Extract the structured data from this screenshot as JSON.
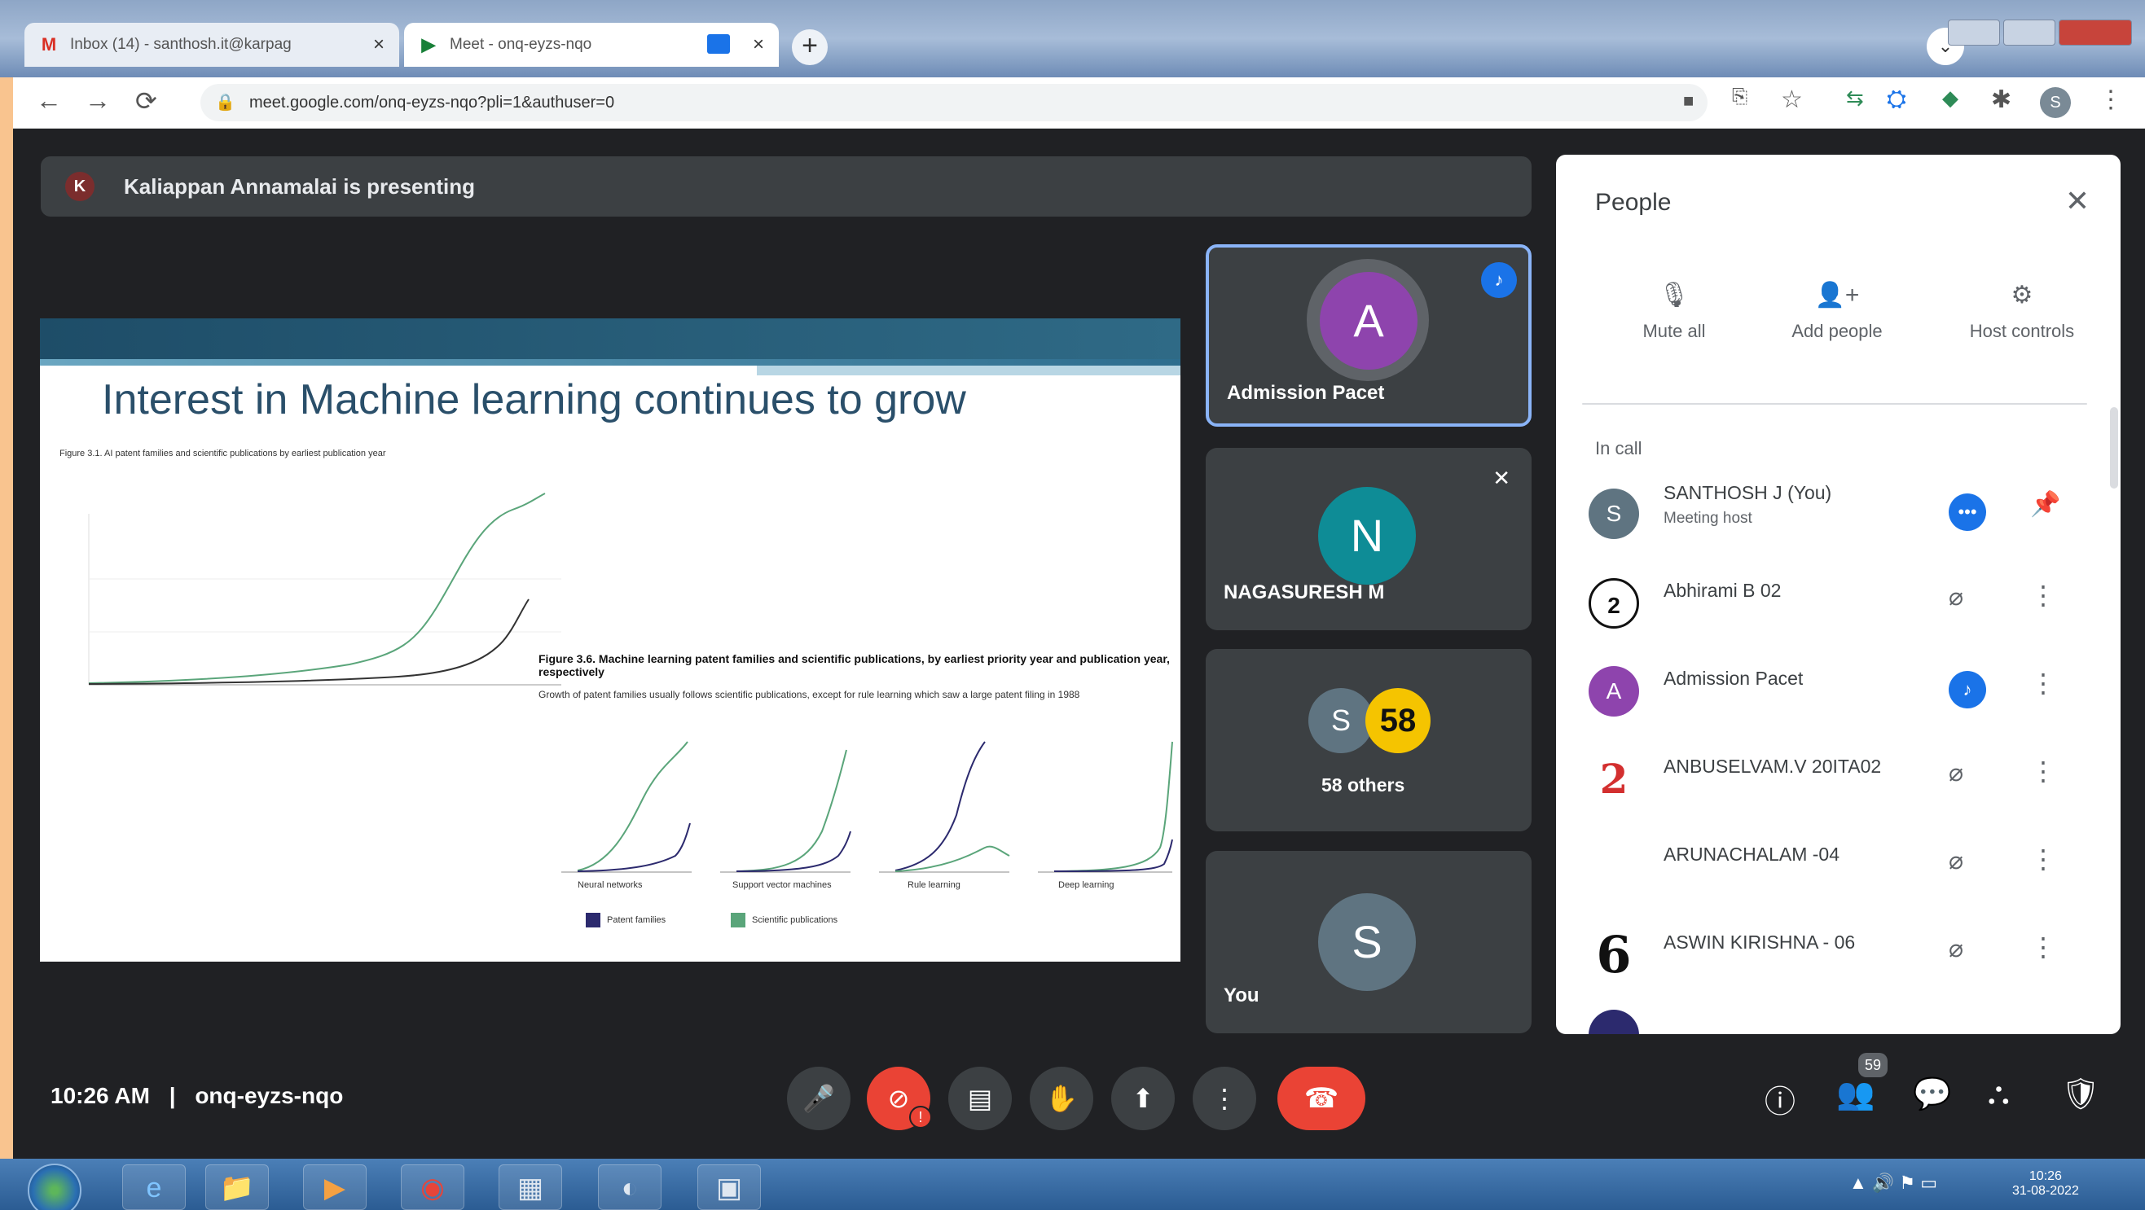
{
  "browser": {
    "tabs": [
      {
        "label": "Inbox (14) - santhosh.it@karpag",
        "icon": "gmail-icon"
      },
      {
        "label": "Meet - onq-eyzs-nqo",
        "icon": "meet-icon"
      }
    ],
    "url": "meet.google.com/onq-eyzs-nqo?pli=1&authuser=0",
    "profile_initial": "S"
  },
  "presentation": {
    "presenter_initial": "K",
    "banner": "Kaliappan Annamalai is presenting",
    "slide_title": "Interest in Machine learning continues to grow",
    "figure_left_caption": "Figure 3.1. AI patent families and scientific publications by earliest publication year",
    "figure_right_title": "Figure 3.6. Machine learning patent families and scientific publications, by earliest priority year and publication year, respectively",
    "figure_right_sub": "Growth of patent families usually follows scientific publications, except for rule learning which saw a large patent filing in 1988",
    "legend": [
      "Patent families",
      "Scientific publications"
    ],
    "subchart_labels": [
      "Neural networks",
      "Support vector machines",
      "Rule learning",
      "Deep learning"
    ]
  },
  "tiles": [
    {
      "initial": "A",
      "name": "Admission Pacet",
      "color": "#8e44ad"
    },
    {
      "initial": "N",
      "name": "NAGASURESH M",
      "color": "#0e8c96"
    },
    {
      "initial": "S",
      "count": "58",
      "name": "58 others",
      "color": "#5f7481"
    },
    {
      "initial": "S",
      "name": "You",
      "color": "#5f7481"
    }
  ],
  "people_panel": {
    "title": "People",
    "actions": [
      "Mute all",
      "Add people",
      "Host controls"
    ],
    "section": "In call",
    "participants": [
      {
        "avatar": "S",
        "name": "SANTHOSH J (You)",
        "sub": "Meeting host",
        "color": "#5f7481"
      },
      {
        "avatar": "2",
        "name": "Abhirami B 02",
        "sub": "",
        "color": "#ffffff"
      },
      {
        "avatar": "A",
        "name": "Admission Pacet",
        "sub": "",
        "color": "#8e44ad"
      },
      {
        "avatar": "2",
        "name": "ANBUSELVAM.V 20ITA02",
        "sub": "",
        "color": "#ffffff"
      },
      {
        "avatar": "",
        "name": "ARUNACHALAM -04",
        "sub": "",
        "color": "#ffffff"
      },
      {
        "avatar": "6",
        "name": "ASWIN KIRISHNA - 06",
        "sub": "",
        "color": "#ffffff"
      }
    ]
  },
  "bottom_bar": {
    "time": "10:26 AM",
    "separator": "|",
    "meeting_code": "onq-eyzs-nqo",
    "people_count": "59"
  },
  "taskbar": {
    "clock_time": "10:26",
    "clock_date": "31-08-2022"
  }
}
